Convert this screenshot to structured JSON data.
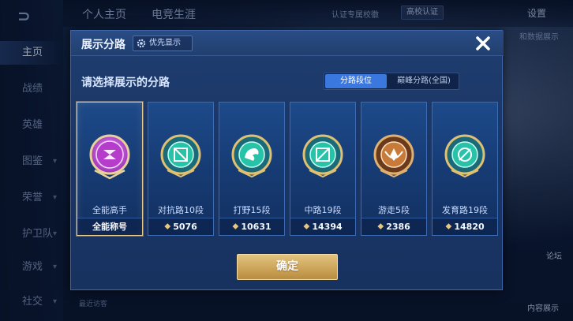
{
  "background": {
    "nav": [
      {
        "label": "主页",
        "active": true
      },
      {
        "label": "战绩"
      },
      {
        "label": "英雄"
      },
      {
        "label": "图鉴"
      },
      {
        "label": "荣誉"
      },
      {
        "label": "护卫队"
      },
      {
        "label": "游戏"
      },
      {
        "label": "社交"
      }
    ],
    "top_tabs": [
      "个人主页",
      "电竞生涯"
    ],
    "top_notice": "认证专属校徽",
    "campus_badge": "高校认证",
    "settings_label": "设置",
    "right_text": "和数据展示",
    "bottom_left": "最近访客",
    "bottom_right": "内容展示",
    "right_tiny": "论坛"
  },
  "modal": {
    "title": "展示分路",
    "priority_label": "优先显示",
    "subtitle": "请选择展示的分路",
    "toggle": [
      {
        "label": "分路段位",
        "active": true
      },
      {
        "label": "巅峰分路(全国)",
        "active": false
      }
    ],
    "cards": [
      {
        "name": "全能高手",
        "footer": "全能称号",
        "points": null,
        "selected": true,
        "emblem": "all-round-icon",
        "color": "#c545d8"
      },
      {
        "name": "对抗路10段",
        "footer": "5076",
        "points": "5076",
        "selected": false,
        "emblem": "sword-icon",
        "color": "#27c2a8"
      },
      {
        "name": "打野15段",
        "footer": "10631",
        "points": "10631",
        "selected": false,
        "emblem": "dragon-icon",
        "color": "#27c2a8"
      },
      {
        "name": "中路19段",
        "footer": "14394",
        "points": "14394",
        "selected": false,
        "emblem": "staff-icon",
        "color": "#27c2a8"
      },
      {
        "name": "游走5段",
        "footer": "2386",
        "points": "2386",
        "selected": false,
        "emblem": "wings-icon",
        "color": "#c77a3a"
      },
      {
        "name": "发育路19段",
        "footer": "14820",
        "points": "14820",
        "selected": false,
        "emblem": "bow-icon",
        "color": "#27c2a8"
      }
    ],
    "confirm_label": "确定"
  },
  "colors": {
    "accent_blue": "#3a78e0",
    "gold": "#e3c47e",
    "panel": "#1f3d70"
  }
}
